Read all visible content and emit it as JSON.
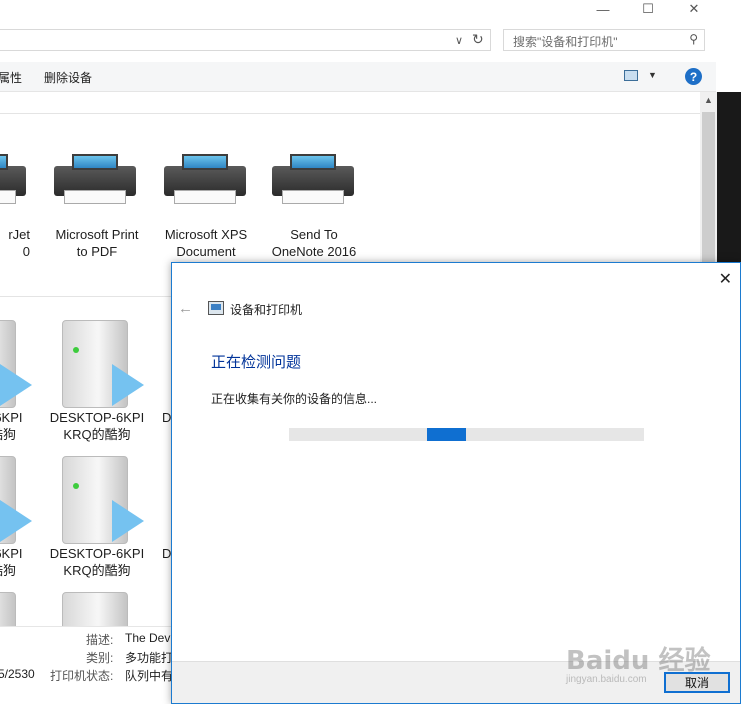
{
  "explorer": {
    "search_placeholder": "搜索\"设备和打印机\"",
    "commands": {
      "properties_partial": "属性",
      "remove_device": "删除设备"
    },
    "printers": [
      {
        "name_line1": "rJet",
        "name_line2": "0"
      },
      {
        "name_line1": "Microsoft Print",
        "name_line2": "to PDF"
      },
      {
        "name_line1": "Microsoft XPS",
        "name_line2": "Document"
      },
      {
        "name_line1": "Send To",
        "name_line2": "OneNote 2016"
      }
    ],
    "computers_row1": [
      {
        "name_line1": "-6KPI",
        "name_line2": "酷狗"
      },
      {
        "name_line1": "DESKTOP-6KPI",
        "name_line2": "KRQ的酷狗"
      },
      {
        "name_line1": "D",
        "name_line2": ""
      }
    ],
    "computers_row2": [
      {
        "name_line1": "-6KPI",
        "name_line2": "酷狗"
      },
      {
        "name_line1": "DESKTOP-6KPI",
        "name_line2": "KRQ的酷狗"
      },
      {
        "name_line1": "D",
        "name_line2": ""
      }
    ],
    "details": {
      "count": "5/2530",
      "desc_label": "描述:",
      "desc_value": "The Dev",
      "category_label": "类别:",
      "category_value": "多功能打",
      "status_label": "打印机状态:",
      "status_value": "队列中有"
    }
  },
  "dialog": {
    "app_title": "设备和打印机",
    "heading": "正在检测问题",
    "status_text": "正在收集有关你的设备的信息...",
    "progress_segment_start": 0.39,
    "progress_segment_width": 0.11,
    "cancel_label": "取消"
  },
  "watermark": {
    "main": "Baidu 经验",
    "sub": "jingyan.baidu.com"
  },
  "icons": [
    "minimize-icon",
    "maximize-icon",
    "close-icon",
    "refresh-icon",
    "search-icon",
    "view-icon",
    "help-icon",
    "back-arrow-icon",
    "printer-icon",
    "computer-icon"
  ]
}
